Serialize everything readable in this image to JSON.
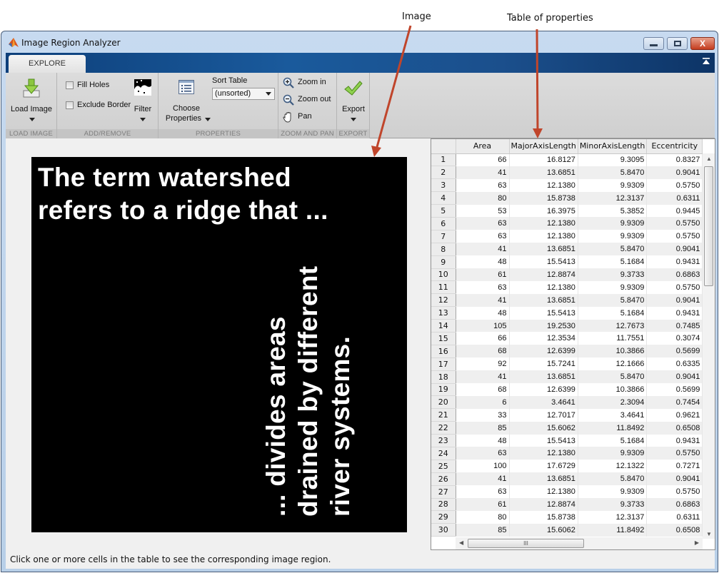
{
  "annotations": {
    "image_label": "Image",
    "table_label": "Table of properties",
    "arrow_color": "#c0452b"
  },
  "window": {
    "title": "Image Region Analyzer",
    "buttons": {
      "minimize": "—",
      "maximize": "□",
      "close": "X"
    }
  },
  "tabs": [
    {
      "label": "EXPLORE",
      "active": true
    }
  ],
  "toolstrip": {
    "load_image": {
      "label": "Load Image",
      "section": "LOAD IMAGE"
    },
    "add_remove": {
      "fill_holes": {
        "label": "Fill Holes",
        "checked": false
      },
      "exclude_border": {
        "label": "Exclude Border",
        "checked": false
      },
      "filter": {
        "label": "Filter"
      },
      "section": "ADD/REMOVE"
    },
    "properties": {
      "choose_properties_line1": "Choose",
      "choose_properties_line2": "Properties",
      "sort_table_label": "Sort Table",
      "sort_table_value": "(unsorted)",
      "section": "PROPERTIES"
    },
    "zoom_pan": {
      "zoom_in": "Zoom in",
      "zoom_out": "Zoom out",
      "pan": "Pan",
      "section": "ZOOM AND PAN"
    },
    "export": {
      "label": "Export",
      "section": "EXPORT"
    }
  },
  "image": {
    "lines_horizontal": [
      "The term watershed",
      "refers to a ridge that ..."
    ],
    "lines_vertical": [
      "... divides areas",
      "drained by different",
      "river systems."
    ]
  },
  "status_text": "Click one or more cells in the table to see the corresponding image region.",
  "table": {
    "columns": [
      "Area",
      "MajorAxisLength",
      "MinorAxisLength",
      "Eccentricity"
    ],
    "rows": [
      [
        "1",
        "66",
        "16.8127",
        "9.3095",
        "0.8327"
      ],
      [
        "2",
        "41",
        "13.6851",
        "5.8470",
        "0.9041"
      ],
      [
        "3",
        "63",
        "12.1380",
        "9.9309",
        "0.5750"
      ],
      [
        "4",
        "80",
        "15.8738",
        "12.3137",
        "0.6311"
      ],
      [
        "5",
        "53",
        "16.3975",
        "5.3852",
        "0.9445"
      ],
      [
        "6",
        "63",
        "12.1380",
        "9.9309",
        "0.5750"
      ],
      [
        "7",
        "63",
        "12.1380",
        "9.9309",
        "0.5750"
      ],
      [
        "8",
        "41",
        "13.6851",
        "5.8470",
        "0.9041"
      ],
      [
        "9",
        "48",
        "15.5413",
        "5.1684",
        "0.9431"
      ],
      [
        "10",
        "61",
        "12.8874",
        "9.3733",
        "0.6863"
      ],
      [
        "11",
        "63",
        "12.1380",
        "9.9309",
        "0.5750"
      ],
      [
        "12",
        "41",
        "13.6851",
        "5.8470",
        "0.9041"
      ],
      [
        "13",
        "48",
        "15.5413",
        "5.1684",
        "0.9431"
      ],
      [
        "14",
        "105",
        "19.2530",
        "12.7673",
        "0.7485"
      ],
      [
        "15",
        "66",
        "12.3534",
        "11.7551",
        "0.3074"
      ],
      [
        "16",
        "68",
        "12.6399",
        "10.3866",
        "0.5699"
      ],
      [
        "17",
        "92",
        "15.7241",
        "12.1666",
        "0.6335"
      ],
      [
        "18",
        "41",
        "13.6851",
        "5.8470",
        "0.9041"
      ],
      [
        "19",
        "68",
        "12.6399",
        "10.3866",
        "0.5699"
      ],
      [
        "20",
        "6",
        "3.4641",
        "2.3094",
        "0.7454"
      ],
      [
        "21",
        "33",
        "12.7017",
        "3.4641",
        "0.9621"
      ],
      [
        "22",
        "85",
        "15.6062",
        "11.8492",
        "0.6508"
      ],
      [
        "23",
        "48",
        "15.5413",
        "5.1684",
        "0.9431"
      ],
      [
        "24",
        "63",
        "12.1380",
        "9.9309",
        "0.5750"
      ],
      [
        "25",
        "100",
        "17.6729",
        "12.1322",
        "0.7271"
      ],
      [
        "26",
        "41",
        "13.6851",
        "5.8470",
        "0.9041"
      ],
      [
        "27",
        "63",
        "12.1380",
        "9.9309",
        "0.5750"
      ],
      [
        "28",
        "61",
        "12.8874",
        "9.3733",
        "0.6863"
      ],
      [
        "29",
        "80",
        "15.8738",
        "12.3137",
        "0.6311"
      ],
      [
        "30",
        "85",
        "15.6062",
        "11.8492",
        "0.6508"
      ]
    ],
    "hscroll_grip": "III"
  }
}
